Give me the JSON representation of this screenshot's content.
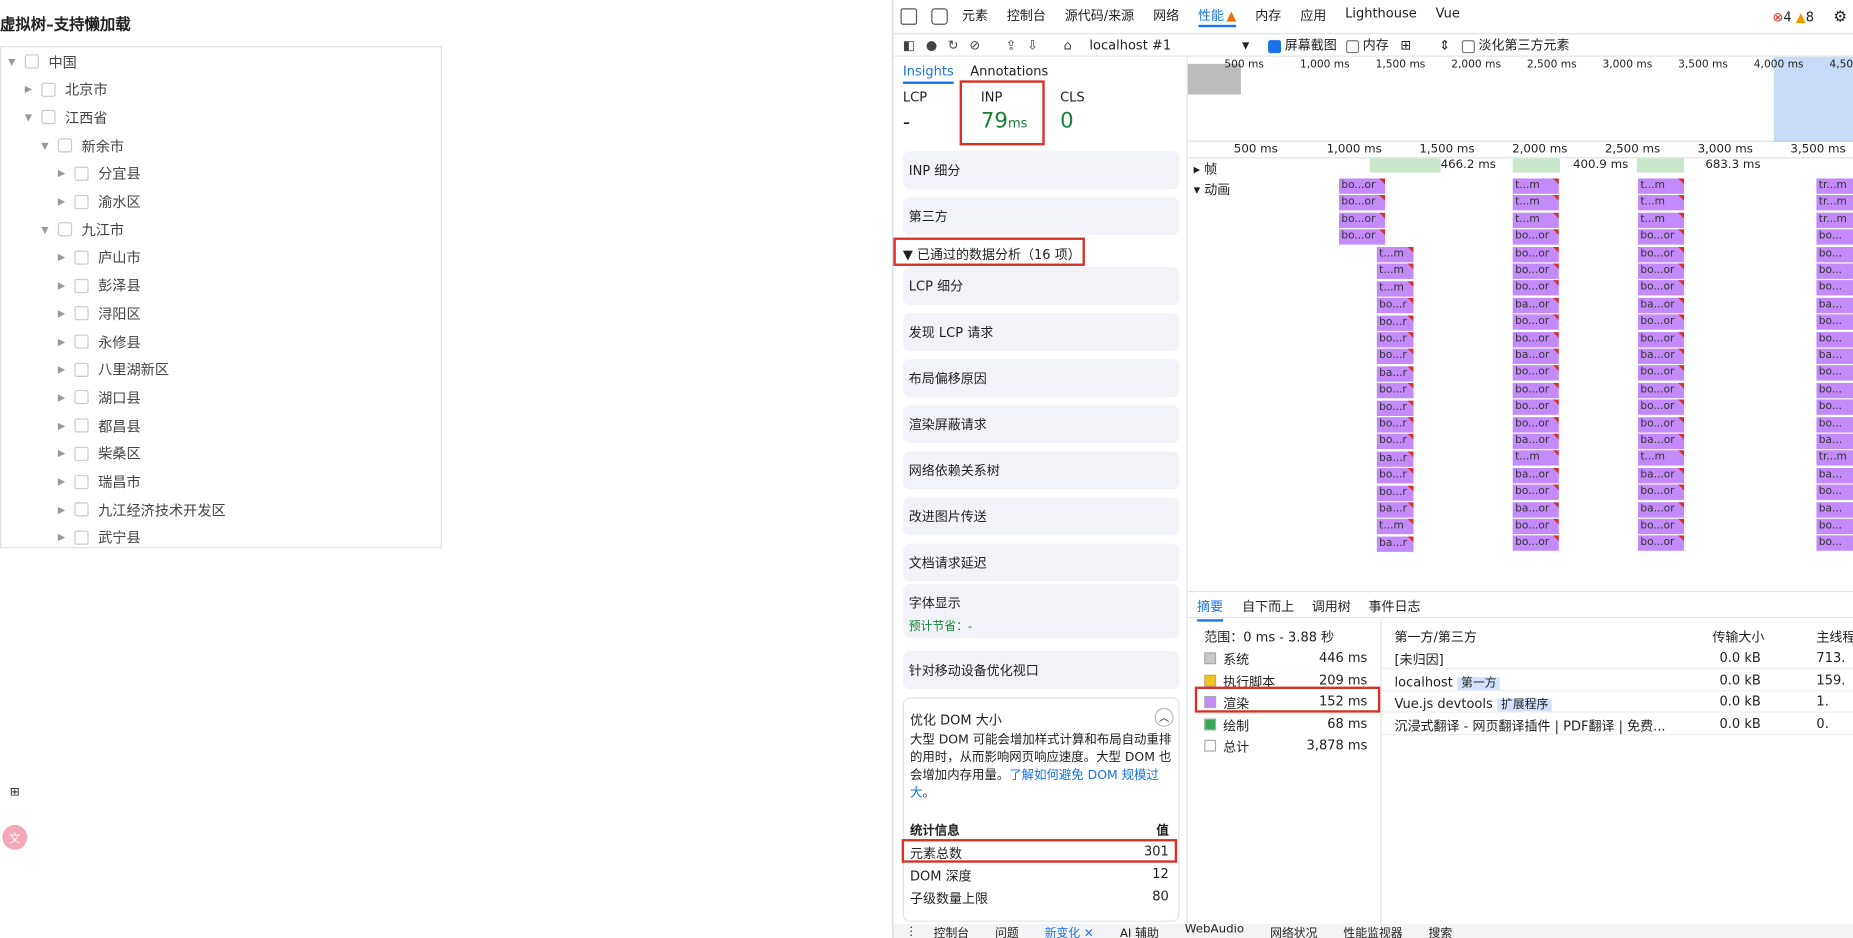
{
  "page": {
    "title": "虚拟树–支持懒加载",
    "tree": [
      {
        "label": "中国",
        "level": 0,
        "open": true
      },
      {
        "label": "北京市",
        "level": 1,
        "open": false
      },
      {
        "label": "江西省",
        "level": 1,
        "open": true
      },
      {
        "label": "新余市",
        "level": 2,
        "open": true
      },
      {
        "label": "分宜县",
        "level": 3,
        "open": false
      },
      {
        "label": "渝水区",
        "level": 3,
        "open": false
      },
      {
        "label": "九江市",
        "level": 2,
        "open": true
      },
      {
        "label": "庐山市",
        "level": 3,
        "open": false
      },
      {
        "label": "彭泽县",
        "level": 3,
        "open": false
      },
      {
        "label": "浔阳区",
        "level": 3,
        "open": false
      },
      {
        "label": "永修县",
        "level": 3,
        "open": false
      },
      {
        "label": "八里湖新区",
        "level": 3,
        "open": false
      },
      {
        "label": "湖口县",
        "level": 3,
        "open": false
      },
      {
        "label": "都昌县",
        "level": 3,
        "open": false
      },
      {
        "label": "柴桑区",
        "level": 3,
        "open": false
      },
      {
        "label": "瑞昌市",
        "level": 3,
        "open": false
      },
      {
        "label": "九江经济技术开发区",
        "level": 3,
        "open": false
      },
      {
        "label": "武宁县",
        "level": 3,
        "open": false
      }
    ],
    "float_icons": [
      "apps-icon",
      "translate-icon"
    ]
  },
  "devtools": {
    "tabs": [
      "元素",
      "控制台",
      "源代码/来源",
      "网络",
      "性能",
      "内存",
      "应用",
      "Lighthouse",
      "Vue"
    ],
    "selected_tab": "性能",
    "errors": "4",
    "warnings": "8",
    "toolbar": {
      "target": "localhost #1",
      "screenshot": "屏幕截图",
      "memory": "内存",
      "dim_third_party": "淡化第三方元素"
    },
    "side_tabs": [
      "Insights",
      "Annotations"
    ],
    "metrics": [
      {
        "name": "LCP",
        "value": "-",
        "unit": ""
      },
      {
        "name": "INP",
        "value": "79",
        "unit": "ms"
      },
      {
        "name": "CLS",
        "value": "0",
        "unit": ""
      }
    ],
    "insights_top": [
      "INP 细分",
      "第三方"
    ],
    "passed_header": "▼ 已通过的数据分析（16 项）",
    "insights_passed": [
      "LCP 细分",
      "发现 LCP 请求",
      "布局偏移原因",
      "渲染屏蔽请求",
      "网络依赖关系树",
      "改进图片传送",
      "文档请求延迟"
    ],
    "font_display": {
      "title": "字体显示",
      "savings": "预计节省：-"
    },
    "viewport": "针对移动设备优化视口",
    "dom_size": {
      "title": "优化 DOM 大小",
      "desc": "大型 DOM 可能会增加样式计算和布局自动重排的用时，从而影响网页响应速度。大型 DOM 也会增加内存用量。",
      "link": "了解如何避免 DOM 规模过大",
      "desc_end": "。",
      "table_header": [
        "统计信息",
        "值"
      ],
      "rows": [
        {
          "k": "元素总数",
          "v": "301"
        },
        {
          "k": "DOM 深度",
          "v": "12"
        },
        {
          "k": "子级数量上限",
          "v": "80"
        }
      ]
    },
    "overview_ticks": [
      "500 ms",
      "1,000 ms",
      "1,500 ms",
      "2,000 ms",
      "2,500 ms",
      "3,000 ms",
      "3,500 ms",
      "4,000 ms",
      "4,500"
    ],
    "ruler_ticks": [
      "500 ms",
      "1,000 ms",
      "1,500 ms",
      "2,000 ms",
      "2,500 ms",
      "3,000 ms",
      "3,500 ms"
    ],
    "frames_label": "▸ 帧",
    "frame_times": [
      "466.2 ms",
      "400.9 ms",
      "683.3 ms"
    ],
    "anim_label": "▾ 动画",
    "anim_columns": [
      {
        "items": [
          "bo...or",
          "bo...or",
          "bo...or",
          "bo...or"
        ]
      },
      {
        "items": [
          "t...m",
          "t...m",
          "t...m",
          "bo...r",
          "bo...r",
          "bo...r",
          "bo...r",
          "ba...r",
          "bo...r",
          "bo...r",
          "bo...r",
          "bo...r",
          "ba...r",
          "bo...r",
          "bo...r",
          "ba...r",
          "t...m",
          "ba...r"
        ]
      },
      {
        "items": [
          "t...m",
          "t...m",
          "t...m",
          "bo...or",
          "bo...or",
          "bo...or",
          "bo...or",
          "ba...or",
          "bo...or",
          "bo...or",
          "ba...or",
          "bo...or",
          "bo...or",
          "bo...or",
          "bo...or",
          "ba...or",
          "t...m",
          "ba...or",
          "bo...or",
          "ba...or",
          "bo...or",
          "bo...or"
        ]
      },
      {
        "items": [
          "t...m",
          "t...m",
          "t...m",
          "bo...or",
          "bo...or",
          "bo...or",
          "bo...or",
          "ba...or",
          "bo...or",
          "bo...or",
          "ba...or",
          "bo...or",
          "bo...or",
          "bo...or",
          "bo...or",
          "ba...or",
          "t...m",
          "ba...or",
          "bo...or",
          "ba...or",
          "bo...or",
          "bo...or"
        ]
      },
      {
        "items": [
          "tr...m",
          "tr...m",
          "tr...m",
          "bo...",
          "bo...",
          "bo...",
          "bo...",
          "ba...",
          "bo...",
          "bo...",
          "ba...",
          "bo...",
          "bo...",
          "bo...",
          "bo...",
          "ba...",
          "tr...m",
          "ba...",
          "bo...",
          "ba...",
          "bo...",
          "bo..."
        ]
      }
    ],
    "bottom_tabs": [
      "摘要",
      "自下而上",
      "调用树",
      "事件日志"
    ],
    "range": "范围：0 ms - 3.88 秒",
    "summary": [
      {
        "label": "系统",
        "value": "446 ms",
        "color": "#c8c8c8"
      },
      {
        "label": "执行脚本",
        "value": "209 ms",
        "color": "#f0c419"
      },
      {
        "label": "渲染",
        "value": "152 ms",
        "color": "#c58af9"
      },
      {
        "label": "绘制",
        "value": "68 ms",
        "color": "#34a853"
      },
      {
        "label": "总计",
        "value": "3,878 ms",
        "color": "#ffffff"
      }
    ],
    "tp_header": [
      "第一方/第三方",
      "传输大小",
      "主线程"
    ],
    "tp_rows": [
      {
        "name": "[未归因]",
        "badge": "",
        "size": "0.0 kB",
        "main": "713."
      },
      {
        "name": "localhost",
        "badge": "第一方",
        "size": "0.0 kB",
        "main": "159."
      },
      {
        "name": "Vue.js devtools",
        "badge": "扩展程序",
        "size": "0.0 kB",
        "main": "1."
      },
      {
        "name": "沉浸式翻译 - 网页翻译插件 | PDF翻译 | 免费...",
        "badge": "",
        "size": "0.0 kB",
        "main": "0."
      }
    ],
    "drawer_tabs": [
      "控制台",
      "问题",
      "新变化 ✕",
      "AI 辅助",
      "WebAudio",
      "网络状况",
      "性能监视器",
      "搜索"
    ]
  }
}
